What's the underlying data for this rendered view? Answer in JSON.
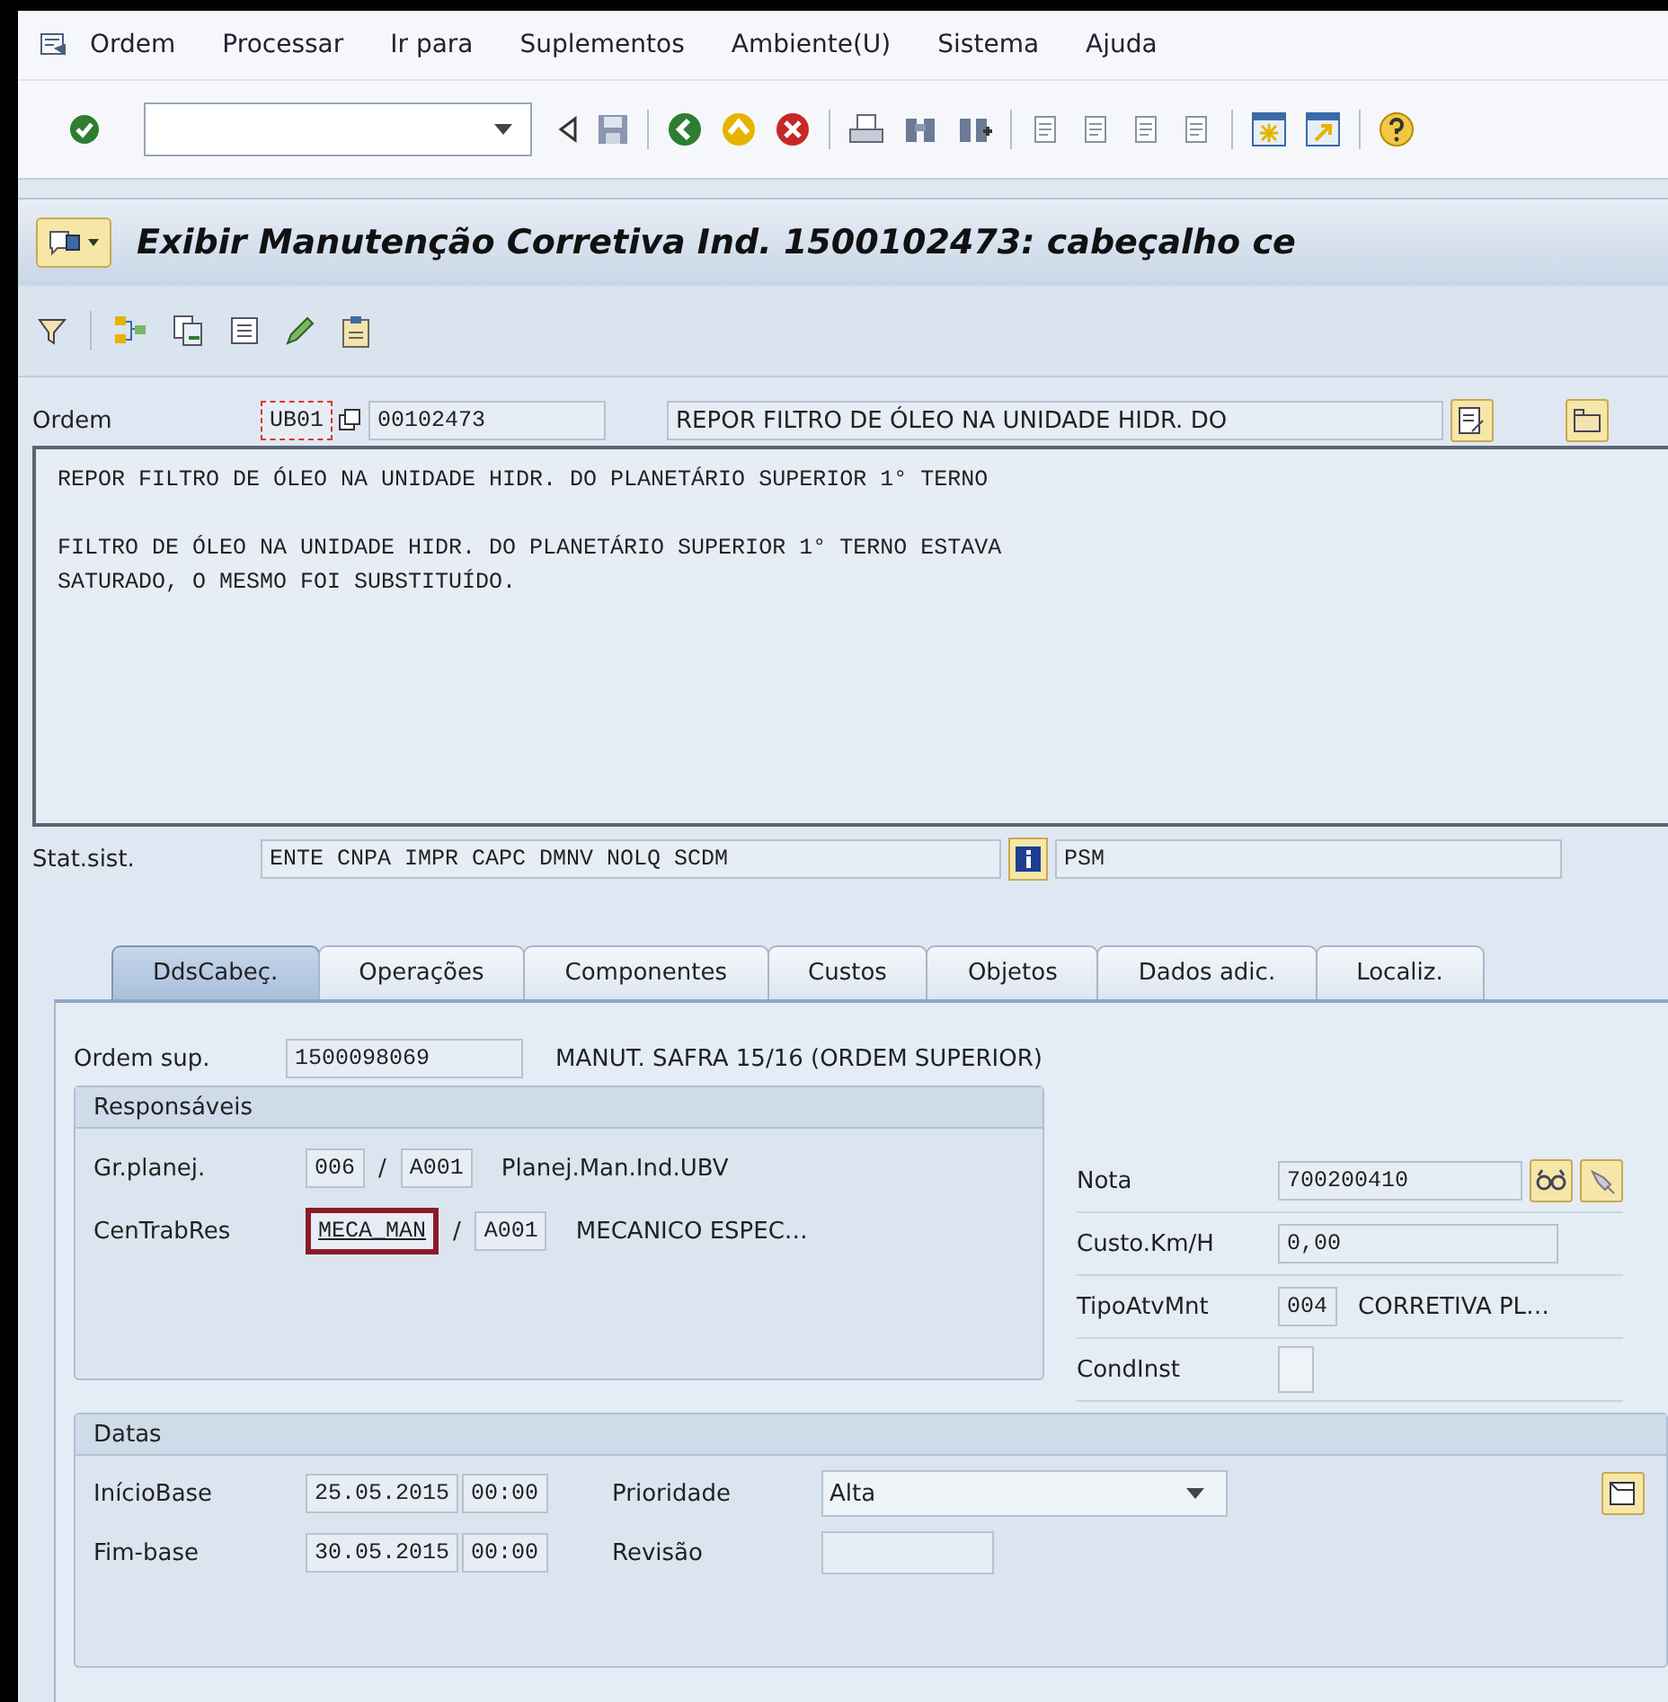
{
  "menu_bar": [
    "Ordem",
    "Processar",
    "Ir para",
    "Suplementos",
    "Ambiente(U)",
    "Sistema",
    "Ajuda"
  ],
  "title": "Exibir Manutenção Corretiva Ind. 1500102473: cabeçalho ce",
  "order": {
    "label": "Ordem",
    "type": "UB01",
    "number": "00102473",
    "description": "REPOR FILTRO DE ÓLEO NA UNIDADE HIDR. DO"
  },
  "long_text": [
    [
      "REPOR FILTRO DE ÓLEO NA UNIDADE HIDR. DO PLANETÁRIO SUPERIOR 1° TERNO"
    ],
    [
      "FILTRO DE ÓLEO NA UNIDADE HIDR. DO PLANETÁRIO SUPERIOR 1° TERNO ESTAVA",
      "SATURADO, O MESMO FOI SUBSTITUÍDO."
    ]
  ],
  "system_status": {
    "label": "Stat.sist.",
    "value": "ENTE CNPA IMPR CAPC DMNV NOLQ SCDM",
    "user_status": "PSM"
  },
  "tabs": [
    {
      "label": "DdsCabeç.",
      "selected": true
    },
    {
      "label": "Operações",
      "selected": false
    },
    {
      "label": "Componentes",
      "selected": false
    },
    {
      "label": "Custos",
      "selected": false
    },
    {
      "label": "Objetos",
      "selected": false
    },
    {
      "label": "Dados adic.",
      "selected": false
    },
    {
      "label": "Localiz.",
      "selected": false
    }
  ],
  "superior_order": {
    "label": "Ordem sup.",
    "value": "1500098069",
    "description": "MANUT. SAFRA 15/16 (ORDEM SUPERIOR)"
  },
  "responsaveis": {
    "title": "Responsáveis",
    "rows": [
      {
        "label": "Gr.planej.",
        "code": "006",
        "separator": "/",
        "plant": "A001",
        "description": "Planej.Man.Ind.UBV",
        "focused": false
      },
      {
        "label": "CenTrabRes",
        "code": "MECA_MAN",
        "separator": "/",
        "plant": "A001",
        "description": "MECANICO ESPEC…",
        "focused": true
      }
    ]
  },
  "notification": {
    "label": "Nota",
    "value": "700200410"
  },
  "cost": {
    "label": "Custo.Km/H",
    "value": "0,00"
  },
  "activity_type": {
    "label": "TipoAtvMnt",
    "value": "004",
    "description": "CORRETIVA PL…"
  },
  "installation": {
    "label": "CondInst"
  },
  "datas": {
    "title": "Datas",
    "rows": [
      {
        "label": "InícioBase",
        "date": "25.05.2015",
        "time": "00:00",
        "right_label": "Prioridade",
        "right_value": "Alta",
        "kind": "dropdown"
      },
      {
        "label": "Fim-base",
        "date": "30.05.2015",
        "time": "00:00",
        "right_label": "Revisão",
        "kind": "field"
      }
    ]
  }
}
